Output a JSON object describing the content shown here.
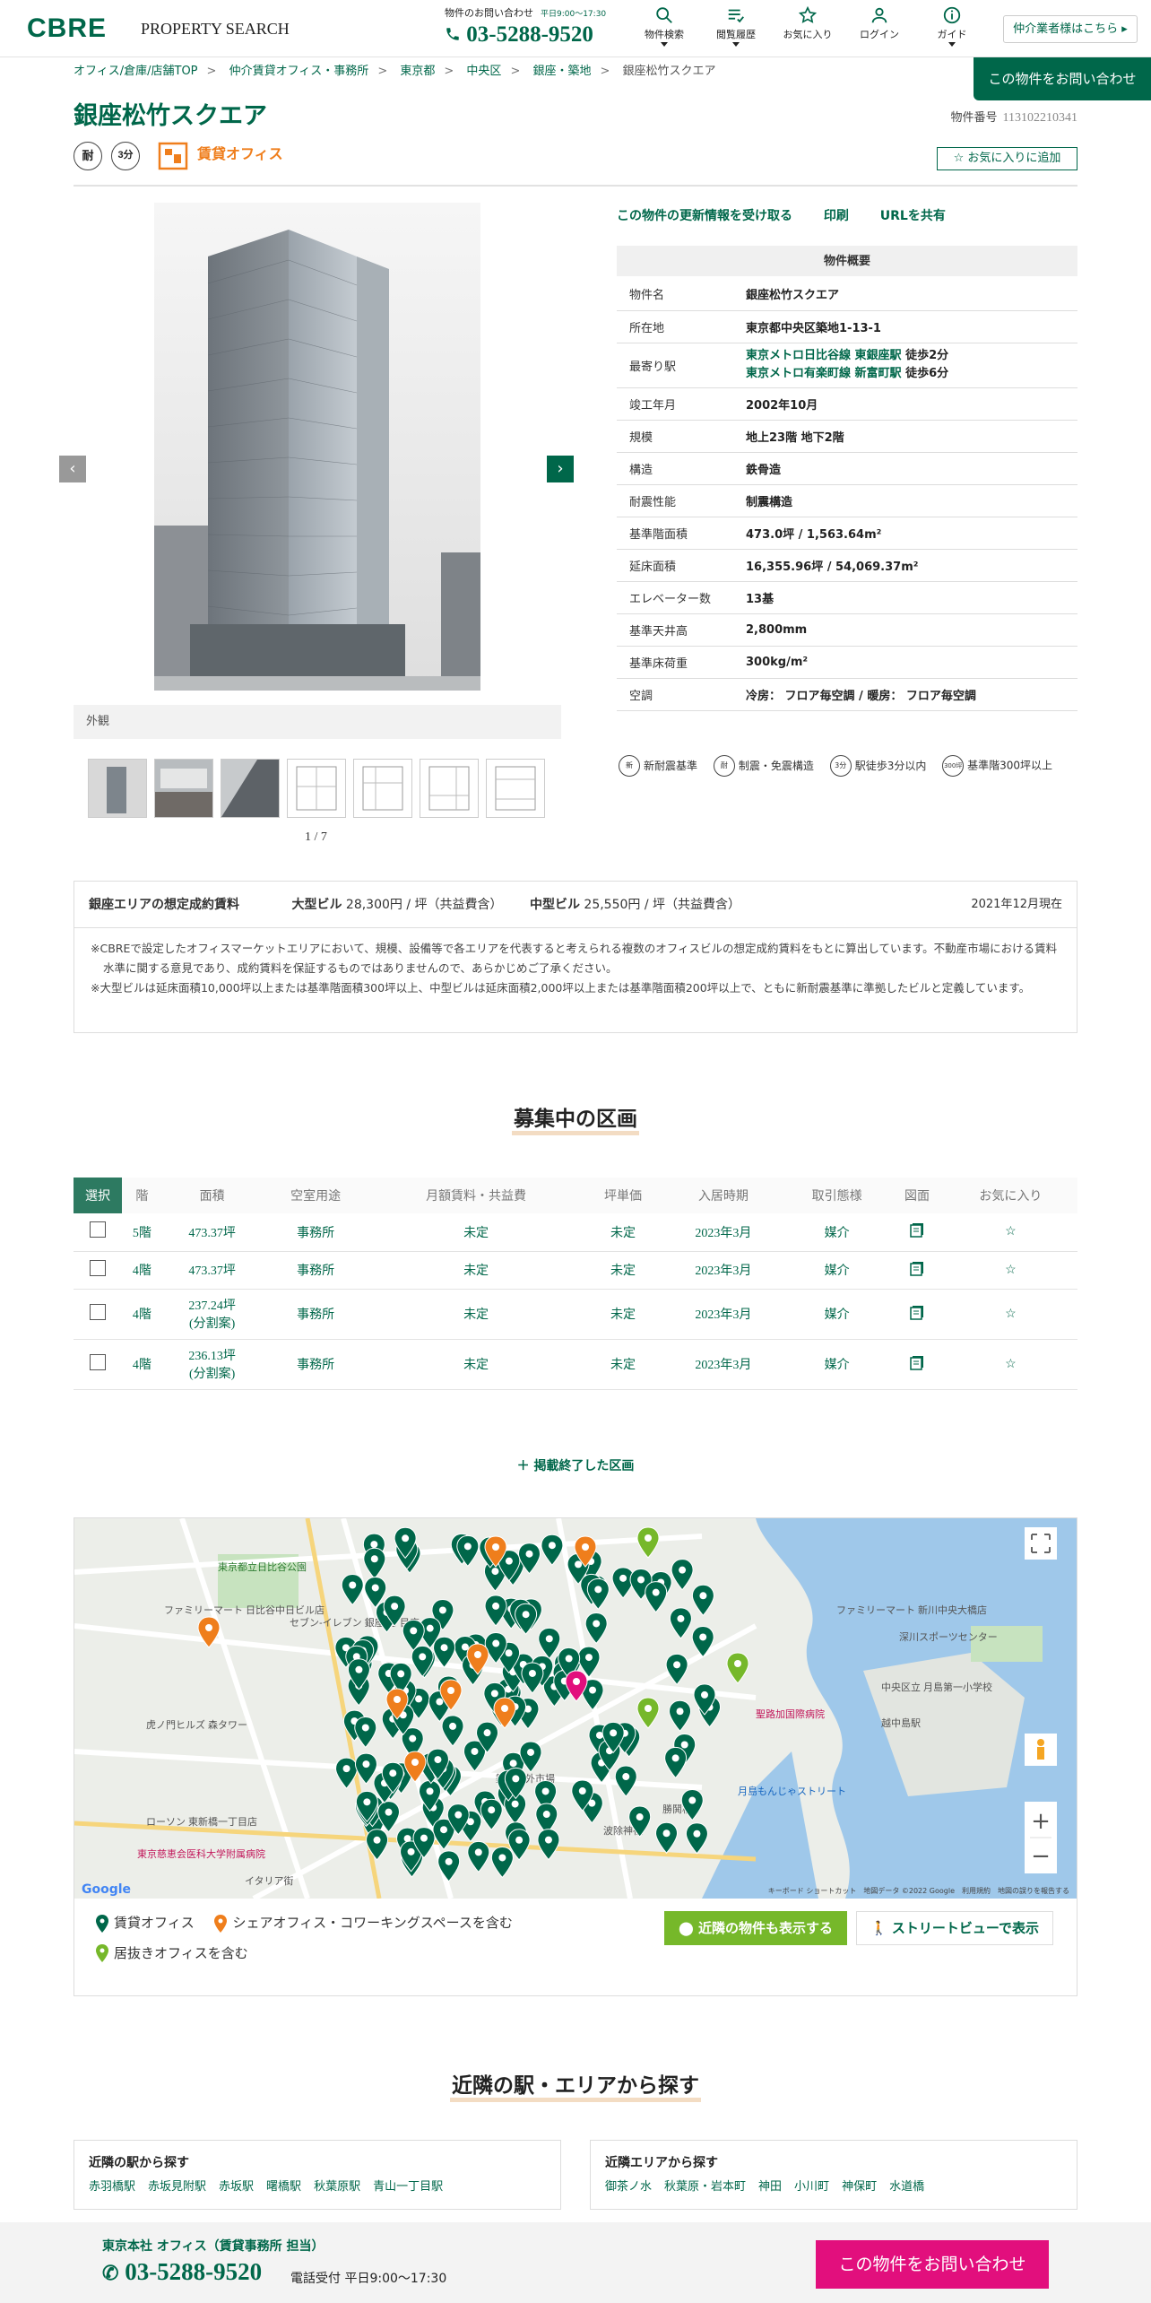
{
  "header": {
    "logo": "CBRE",
    "subtitle": "PROPERTY SEARCH",
    "contact_label": "物件のお問い合わせ",
    "contact_hours": "平日9:00～17:30",
    "phone": "03-5288-9520",
    "nav": [
      {
        "label": "物件検索",
        "icon": "search-icon"
      },
      {
        "label": "閲覧履歴",
        "icon": "history-icon"
      },
      {
        "label": "お気に入り",
        "icon": "star-icon"
      },
      {
        "label": "ログイン",
        "icon": "user-icon"
      },
      {
        "label": "ガイド",
        "icon": "info-icon"
      }
    ],
    "agent_button": "仲介業者様はこちら"
  },
  "breadcrumb": [
    "オフィス/倉庫/店舗TOP",
    "仲介賃貸オフィス・事務所",
    "東京都",
    "中央区",
    "銀座・築地",
    "銀座松竹スクエア"
  ],
  "inquiry_top": "この物件をお問い合わせ",
  "property": {
    "name": "銀座松竹スクエア",
    "number_label": "物件番号",
    "number": "113102210341",
    "badge1": "耐",
    "badge2": "3分",
    "type_tag": "賃貸オフィス",
    "fav_button": "お気に入りに追加"
  },
  "gallery": {
    "caption": "外観",
    "pager": "1 / 7",
    "thumbs": 7
  },
  "actions": {
    "subscribe": "この物件の更新情報を受け取る",
    "print": "印刷",
    "share": "URLを共有"
  },
  "overview": {
    "title": "物件概要",
    "rows": [
      {
        "k": "物件名",
        "v": "銀座松竹スクエア"
      },
      {
        "k": "所在地",
        "v": "東京都中央区築地1-13-1"
      },
      {
        "k": "最寄り駅",
        "v1": "東京メトロ日比谷線 東銀座駅",
        "w1": "徒歩2分",
        "v2": "東京メトロ有楽町線 新富町駅",
        "w2": "徒歩6分"
      },
      {
        "k": "竣工年月",
        "v": "2002年10月"
      },
      {
        "k": "規模",
        "v": "地上23階 地下2階"
      },
      {
        "k": "構造",
        "v": "鉄骨造"
      },
      {
        "k": "耐震性能",
        "v": "制震構造"
      },
      {
        "k": "基準階面積",
        "v": "473.0坪 / 1,563.64m²"
      },
      {
        "k": "延床面積",
        "v": "16,355.96坪 / 54,069.37m²"
      },
      {
        "k": "エレベーター数",
        "v": "13基"
      },
      {
        "k": "基準天井高",
        "v": "2,800mm"
      },
      {
        "k": "基準床荷重",
        "v": "300kg/m²"
      },
      {
        "k": "空調",
        "v": "冷房： フロア毎空調 / 暖房： フロア毎空調"
      }
    ]
  },
  "badges": [
    {
      "icon": "新",
      "label": "新耐震基準"
    },
    {
      "icon": "耐",
      "label": "制震・免震構造"
    },
    {
      "icon": "3分",
      "label": "駅徒歩3分以内"
    },
    {
      "icon": "300坪",
      "label": "基準階300坪以上"
    }
  ],
  "rent": {
    "title": "銀座エリアの想定成約賃料",
    "large_label": "大型ビル",
    "large_value": "28,300円 / 坪（共益費含）",
    "mid_label": "中型ビル",
    "mid_value": "25,550円 / 坪（共益費含）",
    "date": "2021年12月現在",
    "note1": "※CBREで設定したオフィスマーケットエリアにおいて、規模、設備等で各エリアを代表すると考えられる複数のオフィスビルの想定成約賃料をもとに算出しています。不動産市場における賃料水準に関する意見であり、成約賃料を保証するものではありませんので、あらかじめご了承ください。",
    "note2": "※大型ビルは延床面積10,000坪以上または基準階面積300坪以上、中型ビルは延床面積2,000坪以上または基準階面積200坪以上で、ともに新耐震基準に準拠したビルと定義しています。"
  },
  "units": {
    "section_title": "募集中の区画",
    "headers": [
      "選択",
      "階",
      "面積",
      "空室用途",
      "月額賃料・共益費",
      "坪単価",
      "入居時期",
      "取引態様",
      "図面",
      "お気に入り"
    ],
    "rows": [
      {
        "floor": "5階",
        "area": "473.37坪",
        "use": "事務所",
        "rent": "未定",
        "unit": "未定",
        "move": "2023年3月",
        "deal": "媒介"
      },
      {
        "floor": "4階",
        "area": "473.37坪",
        "use": "事務所",
        "rent": "未定",
        "unit": "未定",
        "move": "2023年3月",
        "deal": "媒介"
      },
      {
        "floor": "4階",
        "area": "237.24坪",
        "area2": "(分割案)",
        "use": "事務所",
        "rent": "未定",
        "unit": "未定",
        "move": "2023年3月",
        "deal": "媒介"
      },
      {
        "floor": "4階",
        "area": "236.13坪",
        "area2": "(分割案)",
        "use": "事務所",
        "rent": "未定",
        "unit": "未定",
        "move": "2023年3月",
        "deal": "媒介"
      }
    ],
    "ended_link": "掲載終了した区画"
  },
  "map": {
    "labels": [
      "東京都立日比谷公園",
      "ファミリーマート 日比谷中日ビル店",
      "セブン-イレブン 銀座7丁目店",
      "虎ノ門ヒルズ 森タワー",
      "ファミリーマート 新川中央大橋店",
      "深川スポーツセンター",
      "聖路加国際病院",
      "築地場外市場",
      "月島もんじゃストリート",
      "勝鬨橋",
      "波除神社",
      "東京慈恵会医科大学附属病院",
      "イタリア街",
      "ローソン 東新橋一丁目店",
      "中央区立 月島第一小学校",
      "越中島駅"
    ],
    "attribution": "キーボード ショートカット　地図データ ©2022 Google　利用規約　地図の誤りを報告する",
    "google": "Google"
  },
  "legend": {
    "office": "賃貸オフィス",
    "share": "シェアオフィス・コワーキングスペースを含む",
    "furnished": "居抜きオフィスを含む",
    "nearby_button": "近隣の物件も表示する",
    "street_button": "ストリートビューで表示"
  },
  "nearby": {
    "section_title": "近隣の駅・エリアから探す",
    "stations_title": "近隣の駅から探す",
    "stations": [
      "赤羽橋駅",
      "赤坂見附駅",
      "赤坂駅",
      "曙橋駅",
      "秋葉原駅",
      "青山一丁目駅"
    ],
    "areas_title": "近隣エリアから探す",
    "areas": [
      "御茶ノ水",
      "秋葉原・岩本町",
      "神田",
      "小川町",
      "神保町",
      "水道橋"
    ]
  },
  "footer": {
    "office": "東京本社 オフィス（賃貸事務所 担当）",
    "phone": "03-5288-9520",
    "hours": "電話受付 平日9:00～17:30",
    "button": "この物件をお問い合わせ"
  },
  "colors": {
    "brand": "#00674a",
    "accent": "#ef7e1c",
    "pink": "#e20f7d",
    "lime": "#76b82a"
  }
}
